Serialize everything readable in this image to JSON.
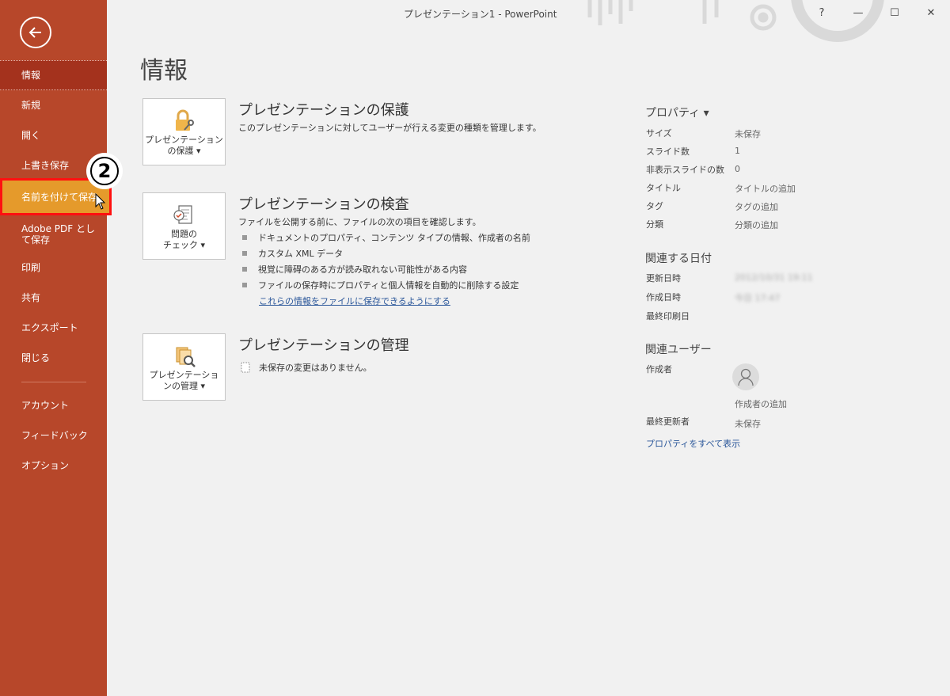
{
  "window": {
    "title": "プレゼンテーション1  -  PowerPoint",
    "help": "?",
    "minimize": "—",
    "maximize": "☐",
    "close": "✕"
  },
  "sidebar": {
    "back_icon": "back-arrow-icon",
    "items": [
      {
        "label": "情報"
      },
      {
        "label": "新規"
      },
      {
        "label": "開く"
      },
      {
        "label": "上書き保存"
      },
      {
        "label": "名前を付けて保存"
      },
      {
        "label": "Adobe PDF として保存"
      },
      {
        "label": "印刷"
      },
      {
        "label": "共有"
      },
      {
        "label": "エクスポート"
      },
      {
        "label": "閉じる"
      },
      {
        "label": "アカウント"
      },
      {
        "label": "フィードバック"
      },
      {
        "label": "オプション"
      }
    ],
    "active_index": 0,
    "highlight_index": 4,
    "step_badge": "2"
  },
  "main": {
    "title": "情報",
    "protect": {
      "card_label_1": "プレゼンテーション",
      "card_label_2": "の保護 ▾",
      "title": "プレゼンテーションの保護",
      "desc": "このプレゼンテーションに対してユーザーが行える変更の種類を管理します。"
    },
    "inspect": {
      "card_label_1": "問題の",
      "card_label_2": "チェック ▾",
      "title": "プレゼンテーションの検査",
      "desc": "ファイルを公開する前に、ファイルの次の項目を確認します。",
      "bullets": [
        "ドキュメントのプロパティ、コンテンツ タイプの情報、作成者の名前",
        "カスタム XML データ",
        "視覚に障碍のある方が読み取れない可能性がある内容",
        "ファイルの保存時にプロパティと個人情報を自動的に削除する設定"
      ],
      "link": "これらの情報をファイルに保存できるようにする"
    },
    "manage": {
      "card_label_1": "プレゼンテーショ",
      "card_label_2": "ンの管理 ▾",
      "title": "プレゼンテーションの管理",
      "desc": "未保存の変更はありません。"
    }
  },
  "properties": {
    "head": "プロパティ ▾",
    "rows": [
      {
        "label": "サイズ",
        "value": "未保存"
      },
      {
        "label": "スライド数",
        "value": "1"
      },
      {
        "label": "非表示スライドの数",
        "value": "0"
      },
      {
        "label": "タイトル",
        "value": "タイトルの追加"
      },
      {
        "label": "タグ",
        "value": "タグの追加"
      },
      {
        "label": "分類",
        "value": "分類の追加"
      }
    ],
    "dates_head": "関連する日付",
    "dates": [
      {
        "label": "更新日時",
        "value": "2012/10/31 19:11"
      },
      {
        "label": "作成日時",
        "value": "今日 17:47"
      },
      {
        "label": "最終印刷日",
        "value": ""
      }
    ],
    "users_head": "関連ユーザー",
    "author_label": "作成者",
    "author_add": "作成者の追加",
    "last_modified_label": "最終更新者",
    "last_modified_value": "未保存",
    "show_all": "プロパティをすべて表示"
  }
}
